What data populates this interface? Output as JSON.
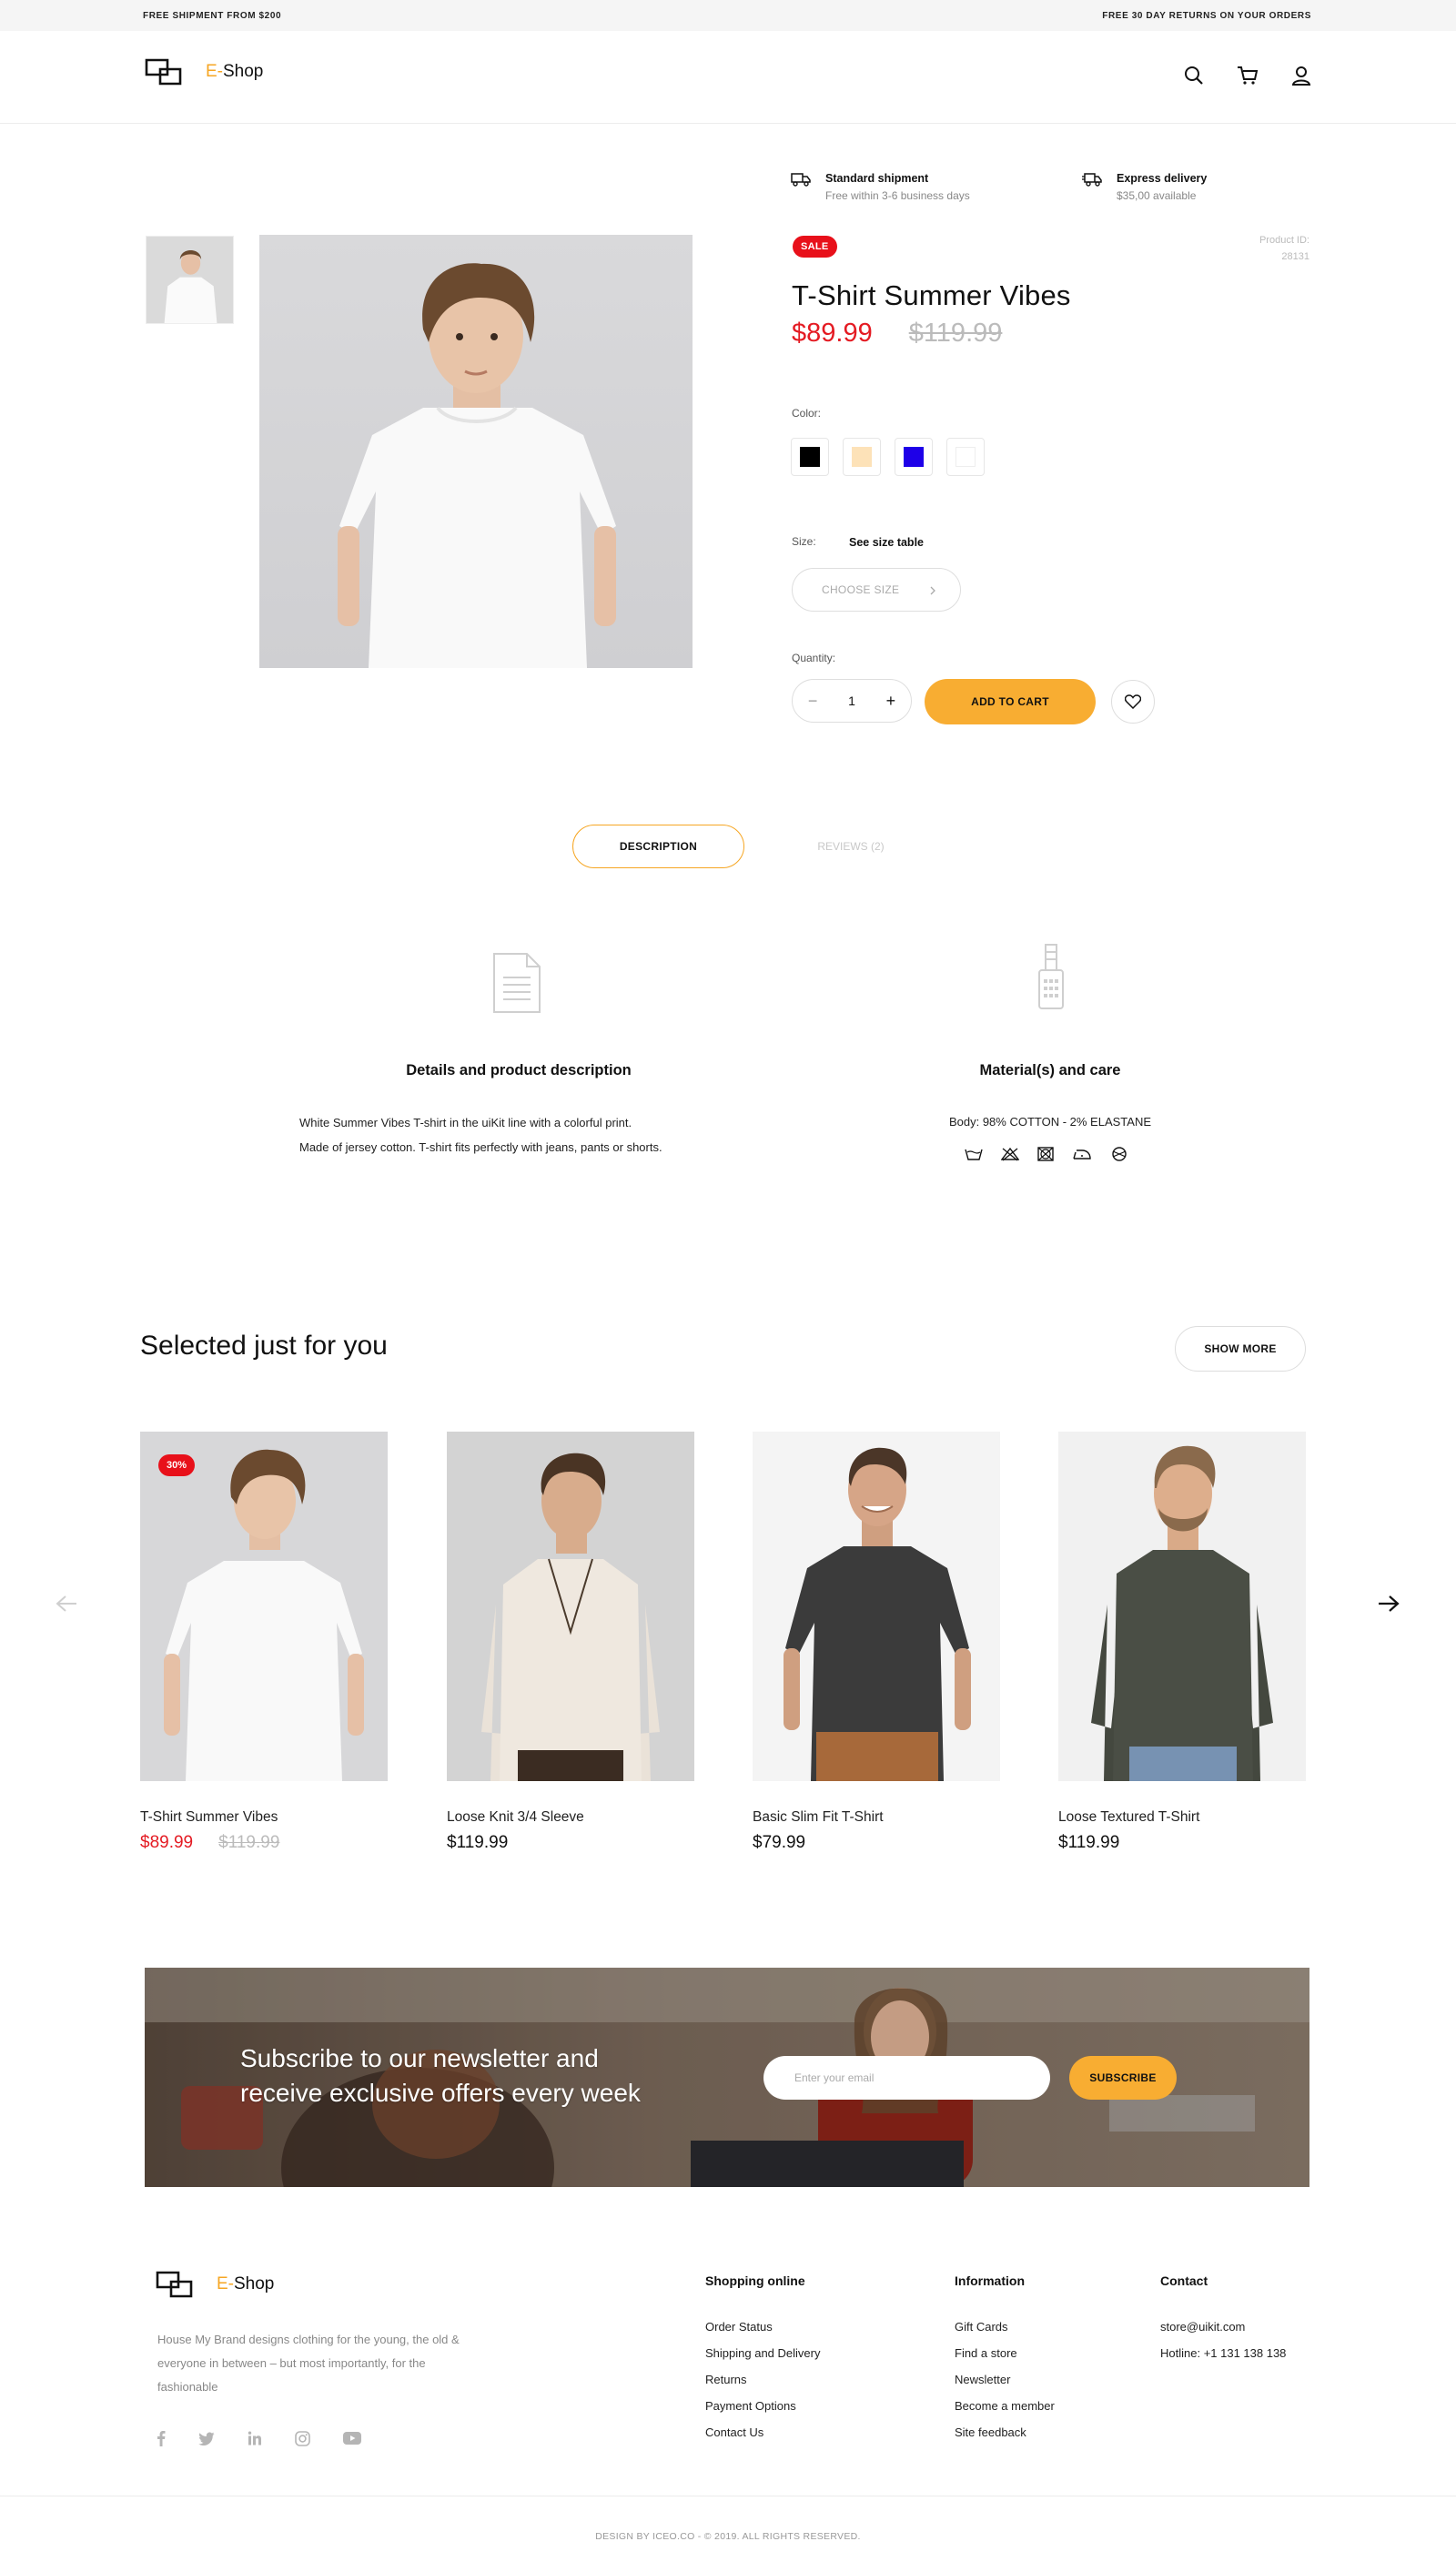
{
  "topbar": {
    "left": "FREE SHIPMENT FROM $200",
    "right": "FREE 30 DAY RETURNS ON YOUR ORDERS"
  },
  "brand": {
    "prefix": "E-",
    "name": "Shop"
  },
  "header_icons": [
    "search-icon",
    "cart-icon",
    "user-icon"
  ],
  "shipping": [
    {
      "title": "Standard shipment",
      "sub": "Free within 3-6 business days",
      "icon": "truck-icon"
    },
    {
      "title": "Express delivery",
      "sub": "$35,00 available",
      "icon": "fast-truck-icon"
    }
  ],
  "product": {
    "badge": "SALE",
    "id_label": "Product ID:",
    "id_value": "28131",
    "title": "T-Shirt Summer Vibes",
    "price": "$89.99",
    "old_price": "$119.99",
    "color_label": "Color:",
    "colors": [
      "#000000",
      "#fde2b8",
      "#1e00e8",
      "#ffffff"
    ],
    "size_label": "Size:",
    "size_table_link": "See size table",
    "size_placeholder": "CHOOSE SIZE",
    "quantity_label": "Quantity:",
    "quantity": "1",
    "add_to_cart": "ADD TO CART"
  },
  "tabs": {
    "description": "DESCRIPTION",
    "reviews": "REVIEWS (2)"
  },
  "details": {
    "title": "Details and product description",
    "line1": "White Summer Vibes T-shirt in the uiKit line with a colorful print.",
    "line2": "Made of jersey cotton. T-shirt fits perfectly with jeans, pants or shorts."
  },
  "material": {
    "title": "Material(s) and care",
    "text": "Body: 98% COTTON - 2% ELASTANE",
    "care_icons": [
      "wash-icon",
      "no-bleach-icon",
      "no-tumble-dry-icon",
      "iron-icon",
      "dry-clean-icon"
    ]
  },
  "recommended": {
    "title": "Selected just for you",
    "show_more": "SHOW MORE",
    "items": [
      {
        "name": "T-Shirt Summer Vibes",
        "price": "$89.99",
        "old_price": "$119.99",
        "badge": "30%"
      },
      {
        "name": "Loose Knit 3/4 Sleeve",
        "price": "$119.99"
      },
      {
        "name": "Basic Slim Fit T-Shirt",
        "price": "$79.99"
      },
      {
        "name": "Loose Textured T-Shirt",
        "price": "$119.99"
      }
    ]
  },
  "newsletter": {
    "line1": "Subscribe to our newsletter and",
    "line2": "receive exclusive offers every week",
    "placeholder": "Enter your email",
    "button": "SUBSCRIBE"
  },
  "footer": {
    "about1": "House My Brand designs clothing for the young, the old &",
    "about2": "everyone in between – but most importantly, for the",
    "about3": "fashionable",
    "social": [
      "facebook-icon",
      "twitter-icon",
      "linkedin-icon",
      "instagram-icon",
      "youtube-icon"
    ],
    "col1": {
      "title": "Shopping online",
      "links": [
        "Order Status",
        "Shipping and Delivery",
        "Returns",
        "Payment Options",
        "Contact Us"
      ]
    },
    "col2": {
      "title": "Information",
      "links": [
        "Gift Cards",
        "Find a store",
        "Newsletter",
        "Become a member",
        "Site feedback"
      ]
    },
    "col3": {
      "title": "Contact",
      "links": [
        "store@uikit.com",
        "Hotline: +1 131 138 138"
      ]
    },
    "copyright": "DESIGN BY ICEO.CO - © 2019. ALL RIGHTS RESERVED."
  }
}
